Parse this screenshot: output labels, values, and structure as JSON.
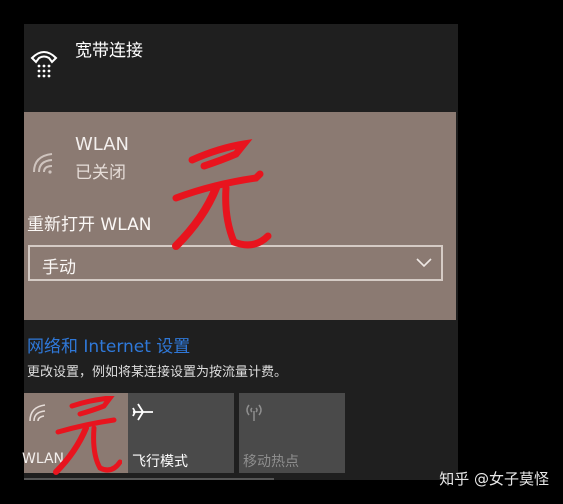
{
  "broadband": {
    "name": "宽带连接",
    "icon": "dialup-phone-icon"
  },
  "wlan": {
    "title": "WLAN",
    "status": "已关闭",
    "reopen_label": "重新打开 WLAN",
    "reopen_selected": "手动",
    "icon": "wifi-icon"
  },
  "settings": {
    "link": "网络和 Internet 设置",
    "description": "更改设置，例如将某连接设置为按流量计费。"
  },
  "quick_actions": [
    {
      "label": "WLAN",
      "icon": "wifi-icon",
      "state": "off"
    },
    {
      "label": "飞行模式",
      "icon": "airplane-icon",
      "state": "off"
    },
    {
      "label": "移动热点",
      "icon": "hotspot-icon",
      "state": "disabled"
    }
  ],
  "annotation": {
    "scribble_text": "无",
    "color": "#e8141e"
  },
  "watermark": "知乎 @女子莫怪",
  "colors": {
    "panel_bg": "#1f1f1f",
    "wlan_bg": "#8b7a72",
    "tile_bg": "#4a4a4a",
    "link": "#2f78d8"
  }
}
